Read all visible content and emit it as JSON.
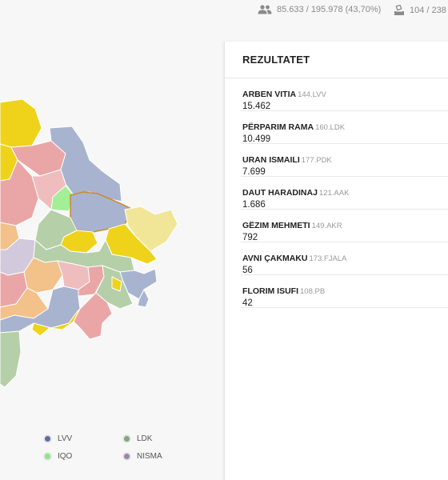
{
  "stats": {
    "voters": "85.633 / 195.978 (43,70%)",
    "stations": "104 / 238",
    "voters_icon": "people-icon",
    "stations_icon": "ballot-box-icon"
  },
  "panel": {
    "title": "REZULTATET",
    "results": [
      {
        "name": "ARBEN VITIA",
        "code": "144.LVV",
        "votes": "15.462"
      },
      {
        "name": "PËRPARIM RAMA",
        "code": "160.LDK",
        "votes": "10.499"
      },
      {
        "name": "URAN ISMAILI",
        "code": "177.PDK",
        "votes": "7.699"
      },
      {
        "name": "DAUT HARADINAJ",
        "code": "121.AAK",
        "votes": "1.686"
      },
      {
        "name": "GËZIM MEHMETI",
        "code": "149.AKR",
        "votes": "792"
      },
      {
        "name": "AVNI ÇAKMAKU",
        "code": "173.FJALA",
        "votes": "56"
      },
      {
        "name": "FLORIM ISUFI",
        "code": "108.PB",
        "votes": "42"
      }
    ]
  },
  "legend": {
    "items": [
      {
        "label": "LVV",
        "color": "#5b6fa3"
      },
      {
        "label": "LDK",
        "color": "#7fa87c"
      },
      {
        "label": "IQO",
        "color": "#8fe58a"
      },
      {
        "label": "NISMA",
        "color": "#9a86a8"
      }
    ]
  },
  "map_colors": {
    "lvv": "#a8b4cf",
    "ldk": "#b5cfa9",
    "pdk": "#efd21a",
    "aak": "#eaa6a6",
    "nisma": "#d2c9dc",
    "iqo": "#a3ee97",
    "orange": "#f3c18a",
    "lightyellow": "#f1e697",
    "pink": "#efbdbd",
    "highlight": "#c98a2c"
  }
}
